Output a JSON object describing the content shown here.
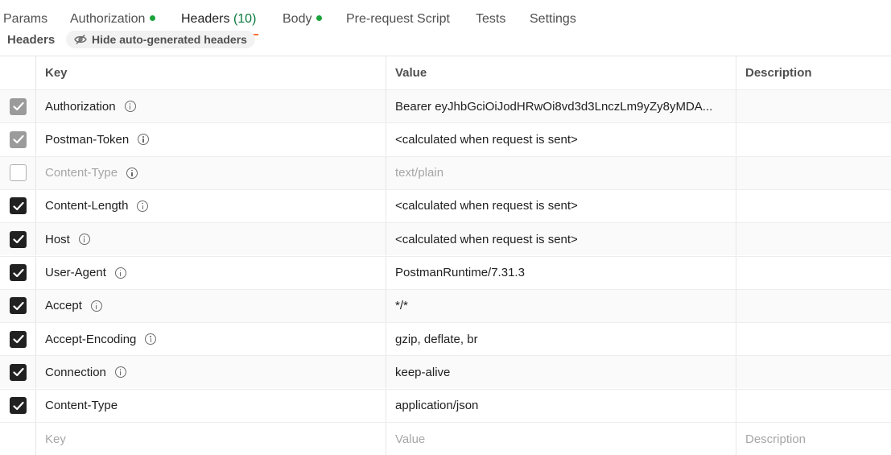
{
  "tabs": [
    {
      "label": "Params",
      "dot": false
    },
    {
      "label": "Authorization",
      "dot": true
    },
    {
      "label": "Headers",
      "count": "(10)",
      "active": true
    },
    {
      "label": "Body",
      "dot": true
    },
    {
      "label": "Pre-request Script"
    },
    {
      "label": "Tests"
    },
    {
      "label": "Settings"
    }
  ],
  "subbar": {
    "title": "Headers",
    "hide_button": "Hide auto-generated headers",
    "hide_icon": "eye-slash-icon"
  },
  "table": {
    "columns": {
      "key": "Key",
      "value": "Value",
      "description": "Description"
    },
    "rows": [
      {
        "key": "Authorization",
        "value": "Bearer eyJhbGciOiJodHRwOi8vd3d3LnczLm9yZy8yMDA...",
        "check": "disabled",
        "info": true
      },
      {
        "key": "Postman-Token",
        "value": "<calculated when request is sent>",
        "check": "disabled",
        "info": true
      },
      {
        "key": "Content-Type",
        "value": "text/plain",
        "check": "off",
        "info": true,
        "muted": true
      },
      {
        "key": "Content-Length",
        "value": "<calculated when request is sent>",
        "check": "on",
        "info": true
      },
      {
        "key": "Host",
        "value": "<calculated when request is sent>",
        "check": "on",
        "info": true
      },
      {
        "key": "User-Agent",
        "value": "PostmanRuntime/7.31.3",
        "check": "on",
        "info": true
      },
      {
        "key": "Accept",
        "value": "*/*",
        "check": "on",
        "info": true
      },
      {
        "key": "Accept-Encoding",
        "value": "gzip, deflate, br",
        "check": "on",
        "info": true
      },
      {
        "key": "Connection",
        "value": "keep-alive",
        "check": "on",
        "info": true
      },
      {
        "key": "Content-Type",
        "value": "application/json",
        "check": "on",
        "info": false
      }
    ],
    "placeholder": {
      "key": "Key",
      "value": "Value",
      "description": "Description"
    }
  },
  "colors": {
    "accent": "#ff6c37",
    "dot": "#1aa33a",
    "count": "#0b7a3e"
  }
}
